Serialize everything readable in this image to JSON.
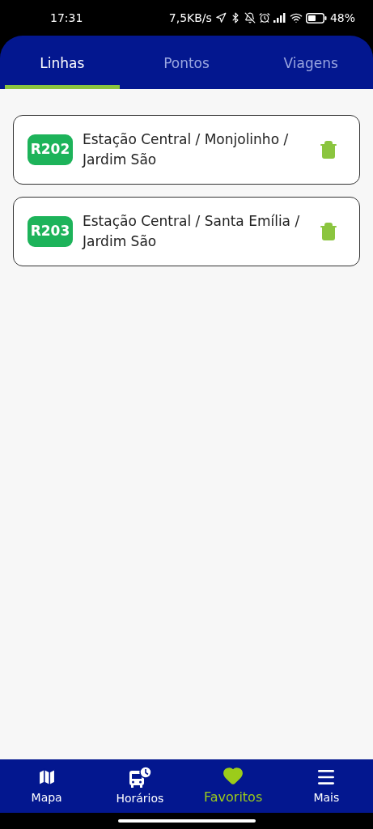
{
  "status_bar": {
    "time": "17:31",
    "speed": "7,5KB/s",
    "battery": "48%"
  },
  "tabs": [
    {
      "label": "Linhas",
      "selected": true
    },
    {
      "label": "Pontos",
      "selected": false
    },
    {
      "label": "Viagens",
      "selected": false
    }
  ],
  "favorites": [
    {
      "code": "R202",
      "name": "Estação Central / Monjolinho / Jardim São"
    },
    {
      "code": "R203",
      "name": "Estação Central / Santa Emília / Jardim São"
    }
  ],
  "bottom_nav": [
    {
      "label": "Mapa",
      "kind": "map",
      "selected": false
    },
    {
      "label": "Horários",
      "kind": "bus",
      "selected": false
    },
    {
      "label": "Favoritos",
      "kind": "heart",
      "selected": true
    },
    {
      "label": "Mais",
      "kind": "menu",
      "selected": false
    }
  ]
}
